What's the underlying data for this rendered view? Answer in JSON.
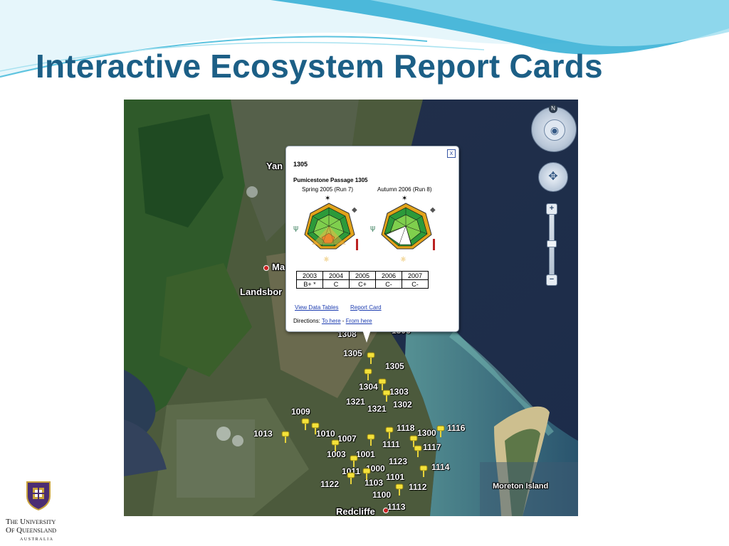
{
  "slide": {
    "title": "Interactive Ecosystem Report Cards"
  },
  "colors": {
    "title": "#1c5f86",
    "swoosh": "#3ab1d6",
    "link": "#1c3cb0"
  },
  "map": {
    "places": [
      "Yan",
      "Ma",
      "Landsbor",
      "Moreton Island",
      "Redcliffe"
    ],
    "sites": [
      "1308",
      "1305",
      "1305",
      "1304",
      "1303",
      "1321",
      "1321",
      "1302",
      "1009",
      "1013",
      "1010",
      "1007",
      "1118",
      "1300",
      "1116",
      "1111",
      "1117",
      "1003",
      "1001",
      "1123",
      "1114",
      "1011",
      "1000",
      "1101",
      "1122",
      "1103",
      "1112",
      "1100",
      "1113",
      "1306"
    ],
    "controls": {
      "north": "N"
    }
  },
  "popup": {
    "id": "1305",
    "title": "Pumicestone Passage 1305",
    "run_left": "Spring 2005 (Run 7)",
    "run_right": "Autumn 2006 (Run 8)",
    "grades": {
      "years": [
        "2003",
        "2004",
        "2005",
        "2006",
        "2007"
      ],
      "values": [
        "B+ *",
        "C",
        "C+",
        "C-",
        "C-"
      ]
    },
    "links": {
      "view_data": "View Data Tables",
      "report_card": "Report Card",
      "to_here": "To here",
      "from_here": "From here"
    },
    "directions_label": "Directions:",
    "separator": "-",
    "close": "x"
  },
  "logo": {
    "line1": "The University",
    "line2": "Of Queensland",
    "line3": "AUSTRALIA"
  }
}
